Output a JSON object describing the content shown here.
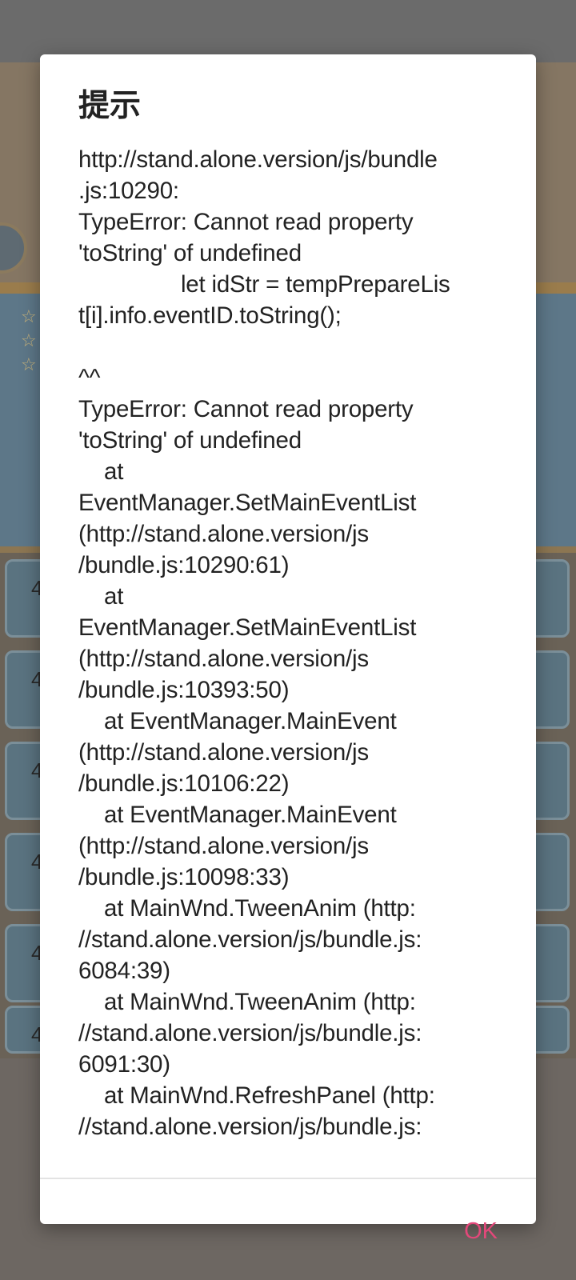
{
  "colors": {
    "accent": "#e2487a",
    "dialog_background": "#ffffff",
    "text": "#222222"
  },
  "dialog": {
    "title": "提示",
    "message": "http://stand.alone.version/js/bundle\n.js:10290:\nTypeError: Cannot read property\n'toString' of undefined\n                let idStr = tempPrepareLis\nt[i].info.eventID.toString();\n\n^^\nTypeError: Cannot read property\n'toString' of undefined\n    at\nEventManager.SetMainEventList\n(http://stand.alone.version/js\n/bundle.js:10290:61)\n    at\nEventManager.SetMainEventList\n(http://stand.alone.version/js\n/bundle.js:10393:50)\n    at EventManager.MainEvent\n(http://stand.alone.version/js\n/bundle.js:10106:22)\n    at EventManager.MainEvent\n(http://stand.alone.version/js\n/bundle.js:10098:33)\n    at MainWnd.TweenAnim (http:\n//stand.alone.version/js/bundle.js:\n6084:39)\n    at MainWnd.TweenAnim (http:\n//stand.alone.version/js/bundle.js:\n6091:30)\n    at MainWnd.RefreshPanel (http:\n//stand.alone.version/js/bundle.js:",
    "ok_label": "OK"
  },
  "background": {
    "card_numbers": [
      "4",
      "4",
      "4",
      "4",
      "4",
      "4"
    ],
    "star_icons": [
      "star-icon",
      "star-icon",
      "star-icon"
    ]
  }
}
